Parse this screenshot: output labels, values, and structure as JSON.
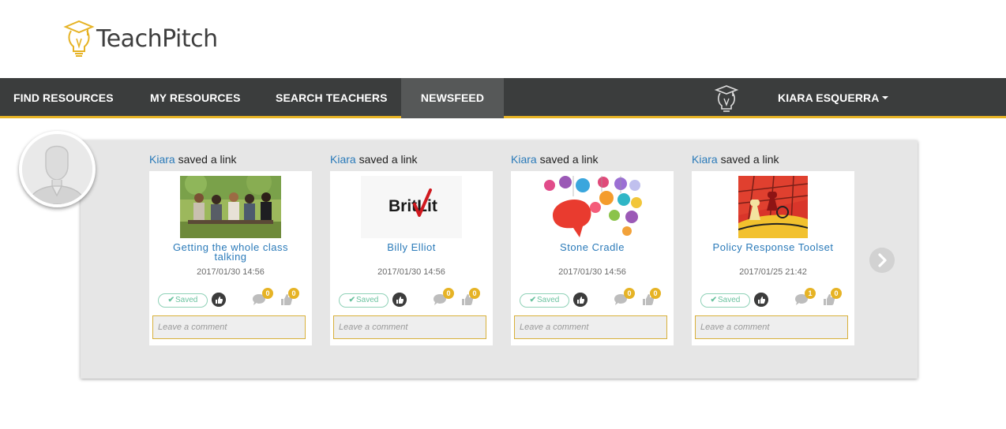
{
  "brand": {
    "name": "TeachPitch"
  },
  "nav": {
    "items": [
      {
        "label": "FIND RESOURCES"
      },
      {
        "label": "MY RESOURCES"
      },
      {
        "label": "SEARCH TEACHERS"
      },
      {
        "label": "NEWSFEED",
        "active": true
      }
    ],
    "user_name": "KIARA ESQUERRA"
  },
  "feed": {
    "items": [
      {
        "user": "Kiara",
        "action": " saved a link",
        "title": "Getting the whole class talking",
        "date": "2017/01/30 14:56",
        "saved_label": "Saved",
        "comment_count": "0",
        "like_count": "0",
        "comment_placeholder": "Leave a comment"
      },
      {
        "user": "Kiara",
        "action": " saved a link",
        "title": "Billy Elliot",
        "date": "2017/01/30 14:56",
        "saved_label": "Saved",
        "comment_count": "0",
        "like_count": "0",
        "comment_placeholder": "Leave a comment",
        "thumb_logo_text": "BritLit"
      },
      {
        "user": "Kiara",
        "action": " saved a link",
        "title": "Stone Cradle",
        "date": "2017/01/30 14:56",
        "saved_label": "Saved",
        "comment_count": "0",
        "like_count": "0",
        "comment_placeholder": "Leave a comment"
      },
      {
        "user": "Kiara",
        "action": " saved a link",
        "title": "Policy Response Toolset",
        "date": "2017/01/25 21:42",
        "saved_label": "Saved",
        "comment_count": "1",
        "like_count": "0",
        "comment_placeholder": "Leave a comment"
      }
    ]
  },
  "colors": {
    "nav_bg": "#3b3d3d",
    "nav_active": "#565858",
    "accent": "#e6b325",
    "link": "#2a7ab9",
    "saved": "#6cc3a0"
  },
  "icons": [
    "teachpitch-logo-icon",
    "teacher-icon",
    "caret-down-icon",
    "avatar-placeholder-icon",
    "check-icon",
    "thumbs-up-icon",
    "comment-icon",
    "next-arrow-icon"
  ]
}
